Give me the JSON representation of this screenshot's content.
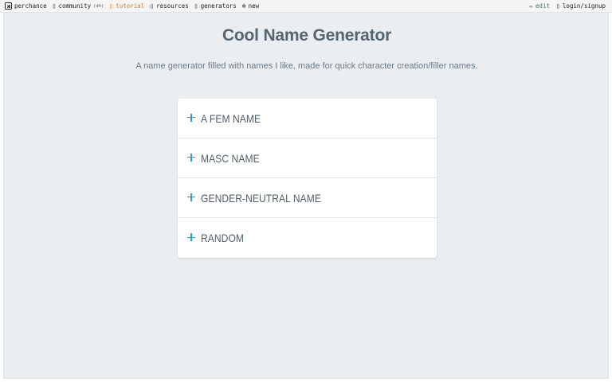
{
  "nav": {
    "left": [
      {
        "icon": "dice-icon",
        "label": "perchance"
      },
      {
        "icon": "chat-icon",
        "glyph": "▯",
        "label": "community",
        "tag": "(dh)"
      },
      {
        "icon": "book-icon",
        "glyph": "▯",
        "label": "tutorial"
      },
      {
        "icon": "folder-icon",
        "glyph": "▯",
        "label": "resources"
      },
      {
        "icon": "grid-icon",
        "glyph": "▯",
        "label": "generators"
      },
      {
        "icon": "plus-circle-icon",
        "glyph": "⊕",
        "label": "new"
      }
    ],
    "right": [
      {
        "icon": "pencil-icon",
        "glyph": "✏",
        "label": "edit"
      },
      {
        "icon": "user-icon",
        "glyph": "▯",
        "label": "login/signup"
      }
    ]
  },
  "main": {
    "title": "Cool Name Generator",
    "subtitle": "A name generator filled with names I like, made for quick character creation/filler names.",
    "options": [
      {
        "label": "A FEM NAME"
      },
      {
        "label": "MASC NAME"
      },
      {
        "label": "GENDER-NEUTRAL NAME"
      },
      {
        "label": "RANDOM"
      }
    ]
  },
  "colors": {
    "accent": "#2b9bc9",
    "title": "#546470",
    "background": "#eaeef1",
    "tutorial": "#e07b1a",
    "edit": "#2e8b3d"
  }
}
